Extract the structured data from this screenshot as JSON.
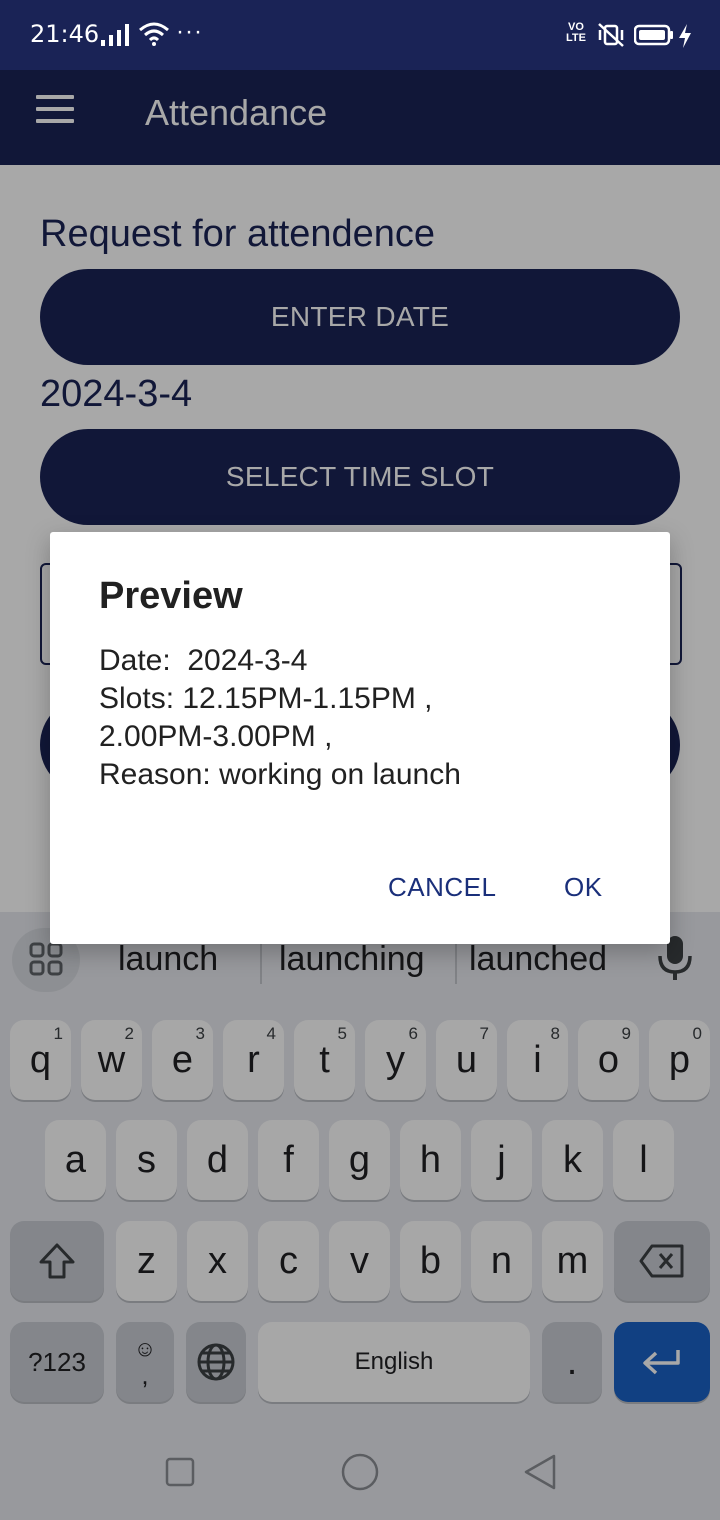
{
  "status_bar": {
    "time": "21:46",
    "dots": "···",
    "volte": "VO\nLTE",
    "icons": [
      "signal-icon",
      "wifi-icon",
      "volte-icon",
      "vibrate-mute-icon",
      "battery-icon",
      "charging-icon"
    ]
  },
  "app_bar": {
    "title": "Attendance",
    "icon": "menu-icon"
  },
  "form": {
    "heading": "Request for attendence",
    "enter_date_label": "ENTER DATE",
    "date_value": "2024-3-4",
    "select_slot_label": "SELECT TIME SLOT"
  },
  "dialog": {
    "title": "Preview",
    "date_line": "Date:  2024-3-4",
    "slots_line": "Slots: 12.15PM-1.15PM ,",
    "slots_line2": "2.00PM-3.00PM ,",
    "reason_line": "Reason: working on launch",
    "cancel_label": "CANCEL",
    "ok_label": "OK"
  },
  "keyboard": {
    "suggestions": [
      "launch",
      "launching",
      "launched"
    ],
    "row1": [
      {
        "k": "q",
        "h": "1"
      },
      {
        "k": "w",
        "h": "2"
      },
      {
        "k": "e",
        "h": "3"
      },
      {
        "k": "r",
        "h": "4"
      },
      {
        "k": "t",
        "h": "5"
      },
      {
        "k": "y",
        "h": "6"
      },
      {
        "k": "u",
        "h": "7"
      },
      {
        "k": "i",
        "h": "8"
      },
      {
        "k": "o",
        "h": "9"
      },
      {
        "k": "p",
        "h": "0"
      }
    ],
    "row2": [
      "a",
      "s",
      "d",
      "f",
      "g",
      "h",
      "j",
      "k",
      "l"
    ],
    "row3": [
      "z",
      "x",
      "c",
      "v",
      "b",
      "n",
      "m"
    ],
    "sym_label": "?123",
    "comma_label": ",",
    "emoji_label": "☺",
    "space_label": "English",
    "period_label": "."
  },
  "colors": {
    "primary": "#1a2356",
    "dialog_button": "#1a2f7a",
    "enter_key": "#1b62c6"
  }
}
